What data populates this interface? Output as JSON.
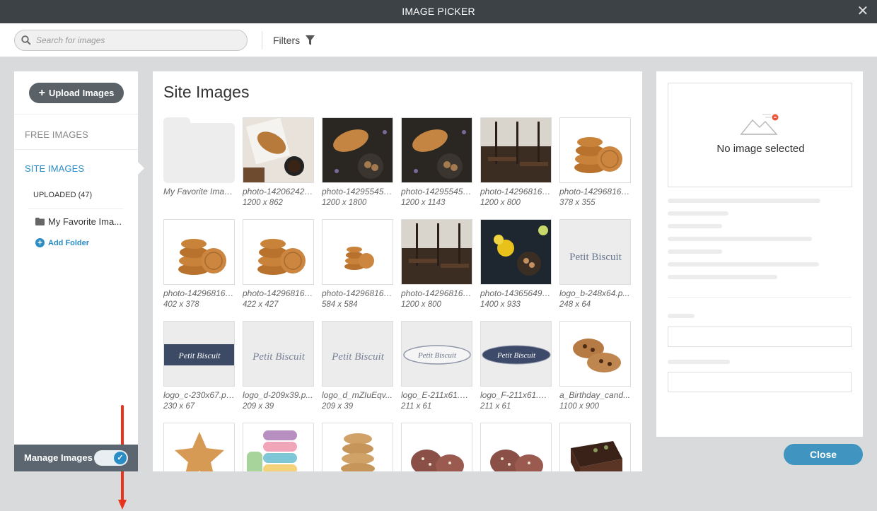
{
  "window": {
    "title": "IMAGE PICKER",
    "close_glyph": "✕"
  },
  "toolbar": {
    "search_placeholder": "Search for images",
    "filters_label": "Filters"
  },
  "sidebar": {
    "upload_label": "Upload Images",
    "free_images": "FREE IMAGES",
    "site_images": "SITE IMAGES",
    "uploaded": "UPLOADED (47)",
    "folder": "My Favorite Ima...",
    "add_folder": "Add Folder",
    "manage_images": "Manage Images",
    "manage_toggle_on": true
  },
  "main": {
    "title": "Site Images",
    "tiles": [
      {
        "name": "My Favorite Imag...",
        "dims": "",
        "kind": "folder"
      },
      {
        "name": "photo-142062422...",
        "dims": "1200 x 862",
        "kind": "croissant-desk"
      },
      {
        "name": "photo-142955451...",
        "dims": "1200 x 1800",
        "kind": "croissant-dark"
      },
      {
        "name": "photo-142955451...",
        "dims": "1200 x 1143",
        "kind": "croissant-dark"
      },
      {
        "name": "photo-142968160...",
        "dims": "1200 x 800",
        "kind": "cafe"
      },
      {
        "name": "photo-142968160...",
        "dims": "378 x 355",
        "kind": "cookie-stack"
      },
      {
        "name": "photo-142968160...",
        "dims": "402 x 378",
        "kind": "cookie-stack"
      },
      {
        "name": "photo-142968160...",
        "dims": "422 x 427",
        "kind": "cookie-stack"
      },
      {
        "name": "photo-142968160...",
        "dims": "584 x 584",
        "kind": "cookie-stack-small"
      },
      {
        "name": "photo-142968160...",
        "dims": "1200 x 800",
        "kind": "cafe"
      },
      {
        "name": "photo-143656498...",
        "dims": "1400 x 933",
        "kind": "flowers-dark"
      },
      {
        "name": "logo_b-248x64.p...",
        "dims": "248 x 64",
        "kind": "logo-b"
      },
      {
        "name": "logo_c-230x67.png",
        "dims": "230 x 67",
        "kind": "logo-c"
      },
      {
        "name": "logo_d-209x39.p...",
        "dims": "209 x 39",
        "kind": "logo-d"
      },
      {
        "name": "logo_d_mZIuEqv...",
        "dims": "209 x 39",
        "kind": "logo-d"
      },
      {
        "name": "logo_E-211x61.pn...",
        "dims": "211 x 61",
        "kind": "logo-e"
      },
      {
        "name": "logo_F-211x61.pn...",
        "dims": "211 x 61",
        "kind": "logo-f"
      },
      {
        "name": "a_Birthday_cand...",
        "dims": "1100 x 900",
        "kind": "choc-cookies"
      },
      {
        "name": "",
        "dims": "",
        "kind": "star-cookie"
      },
      {
        "name": "",
        "dims": "",
        "kind": "macarons"
      },
      {
        "name": "",
        "dims": "",
        "kind": "cookie-tower"
      },
      {
        "name": "",
        "dims": "",
        "kind": "pastry"
      },
      {
        "name": "",
        "dims": "",
        "kind": "pastry"
      },
      {
        "name": "",
        "dims": "",
        "kind": "brownie"
      }
    ],
    "logo_text": "Petit Biscuit"
  },
  "details": {
    "no_image": "No image selected"
  },
  "footer": {
    "close_label": "Close"
  },
  "colors": {
    "accent": "#2a8cc4",
    "header": "#3c4246",
    "manage_bar": "#5c6670"
  }
}
